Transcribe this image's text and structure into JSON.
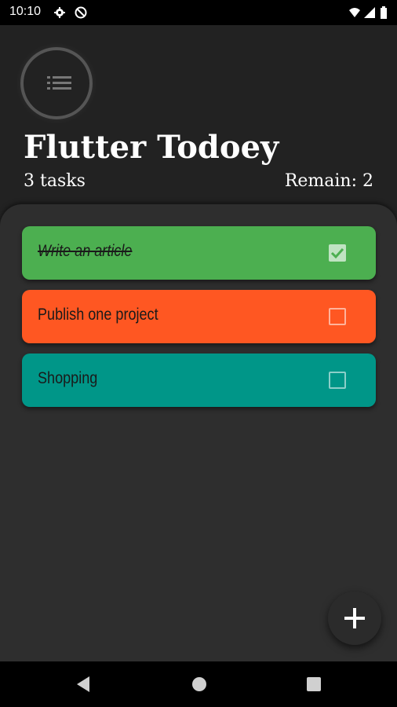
{
  "status_bar": {
    "time": "10:10",
    "icons": [
      "gear-icon",
      "dnd-icon",
      "wifi-icon",
      "signal-icon",
      "battery-icon"
    ]
  },
  "header": {
    "menu_icon": "list-icon",
    "title": "Flutter Todoey",
    "tasks_count": "3 tasks",
    "remain": "Remain: 2"
  },
  "tasks": [
    {
      "label": "Write an article",
      "done": true,
      "color": "#4caf50"
    },
    {
      "label": "Publish one project",
      "done": false,
      "color": "#ff5722"
    },
    {
      "label": "Shopping",
      "done": false,
      "color": "#009688"
    }
  ],
  "fab": {
    "icon": "plus-icon"
  },
  "nav_bar": {
    "icons": [
      "back-icon",
      "home-icon",
      "recents-icon"
    ]
  },
  "colors": {
    "background": "#222222",
    "panel": "#2e2e2e",
    "text": "#ffffff"
  }
}
